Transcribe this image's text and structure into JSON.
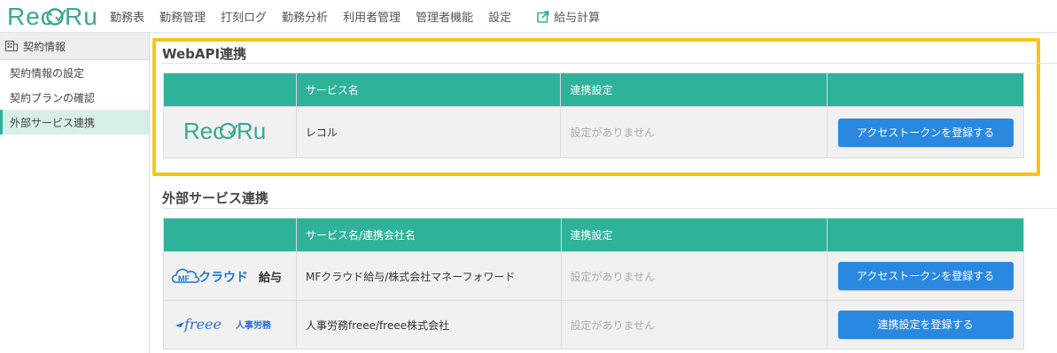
{
  "app": {
    "logo_text": "RecoRu"
  },
  "nav": {
    "items": [
      "勤務表",
      "勤務管理",
      "打刻ログ",
      "勤務分析",
      "利用者管理",
      "管理者機能",
      "設定"
    ],
    "external_label": "給与計算"
  },
  "sidebar": {
    "header": "契約情報",
    "items": [
      {
        "label": "契約情報の設定",
        "active": false
      },
      {
        "label": "契約プランの確認",
        "active": false
      },
      {
        "label": "外部サービス連携",
        "active": true
      }
    ]
  },
  "webapi": {
    "title": "WebAPI連携",
    "headers": [
      "",
      "サービス名",
      "連携設定",
      ""
    ],
    "rows": [
      {
        "logo": "RecoRu",
        "service": "レコル",
        "setting": "設定がありません",
        "button": "アクセストークンを登録する"
      }
    ]
  },
  "external": {
    "title": "外部サービス連携",
    "headers": [
      "",
      "サービス名/連携会社名",
      "連携設定",
      ""
    ],
    "rows": [
      {
        "logo": "MFクラウド給与",
        "service": "MFクラウド給与/株式会社マネーフォワード",
        "setting": "設定がありません",
        "button": "アクセストークンを登録する"
      },
      {
        "logo": "freee 人事労務",
        "service": "人事労務freee/freee株式会社",
        "setting": "設定がありません",
        "button": "連携設定を登録する"
      }
    ]
  },
  "colors": {
    "accent": "#2eb39a",
    "button": "#2a88e0",
    "highlight": "#f5c518",
    "logo": "#3aa88f"
  }
}
